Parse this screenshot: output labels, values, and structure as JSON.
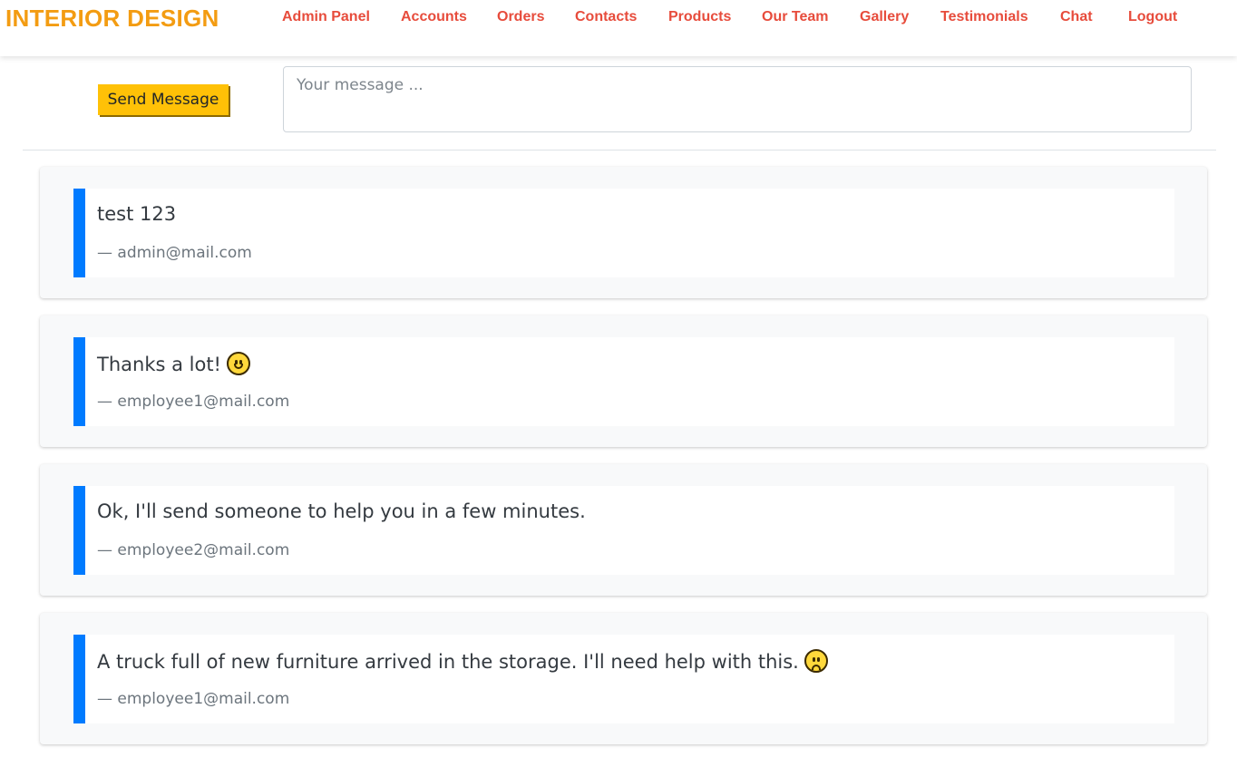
{
  "header": {
    "brand": "INTERIOR DESIGN",
    "nav": [
      "Admin Panel",
      "Accounts",
      "Orders",
      "Contacts",
      "Products",
      "Our Team",
      "Gallery",
      "Testimonials",
      "Chat",
      "Logout"
    ]
  },
  "composer": {
    "send_label": "Send Message",
    "placeholder": "Your message ...",
    "value": ""
  },
  "messages": [
    {
      "text": "test 123",
      "author": "— admin@mail.com",
      "emoji": ""
    },
    {
      "text": "Thanks a lot!",
      "author": "— employee1@mail.com",
      "emoji": "slightly-smiling-face-icon"
    },
    {
      "text": "Ok, I'll send someone to help you in a few minutes.",
      "author": "— employee2@mail.com",
      "emoji": ""
    },
    {
      "text": "A truck full of new furniture arrived in the storage. I'll need help with this.",
      "author": "— employee1@mail.com",
      "emoji": "slightly-frowning-face-icon"
    }
  ],
  "colors": {
    "brand": "#f39c12",
    "nav": "#e74c3c",
    "send_button": "#ffc107",
    "quote_border": "#007bff"
  }
}
